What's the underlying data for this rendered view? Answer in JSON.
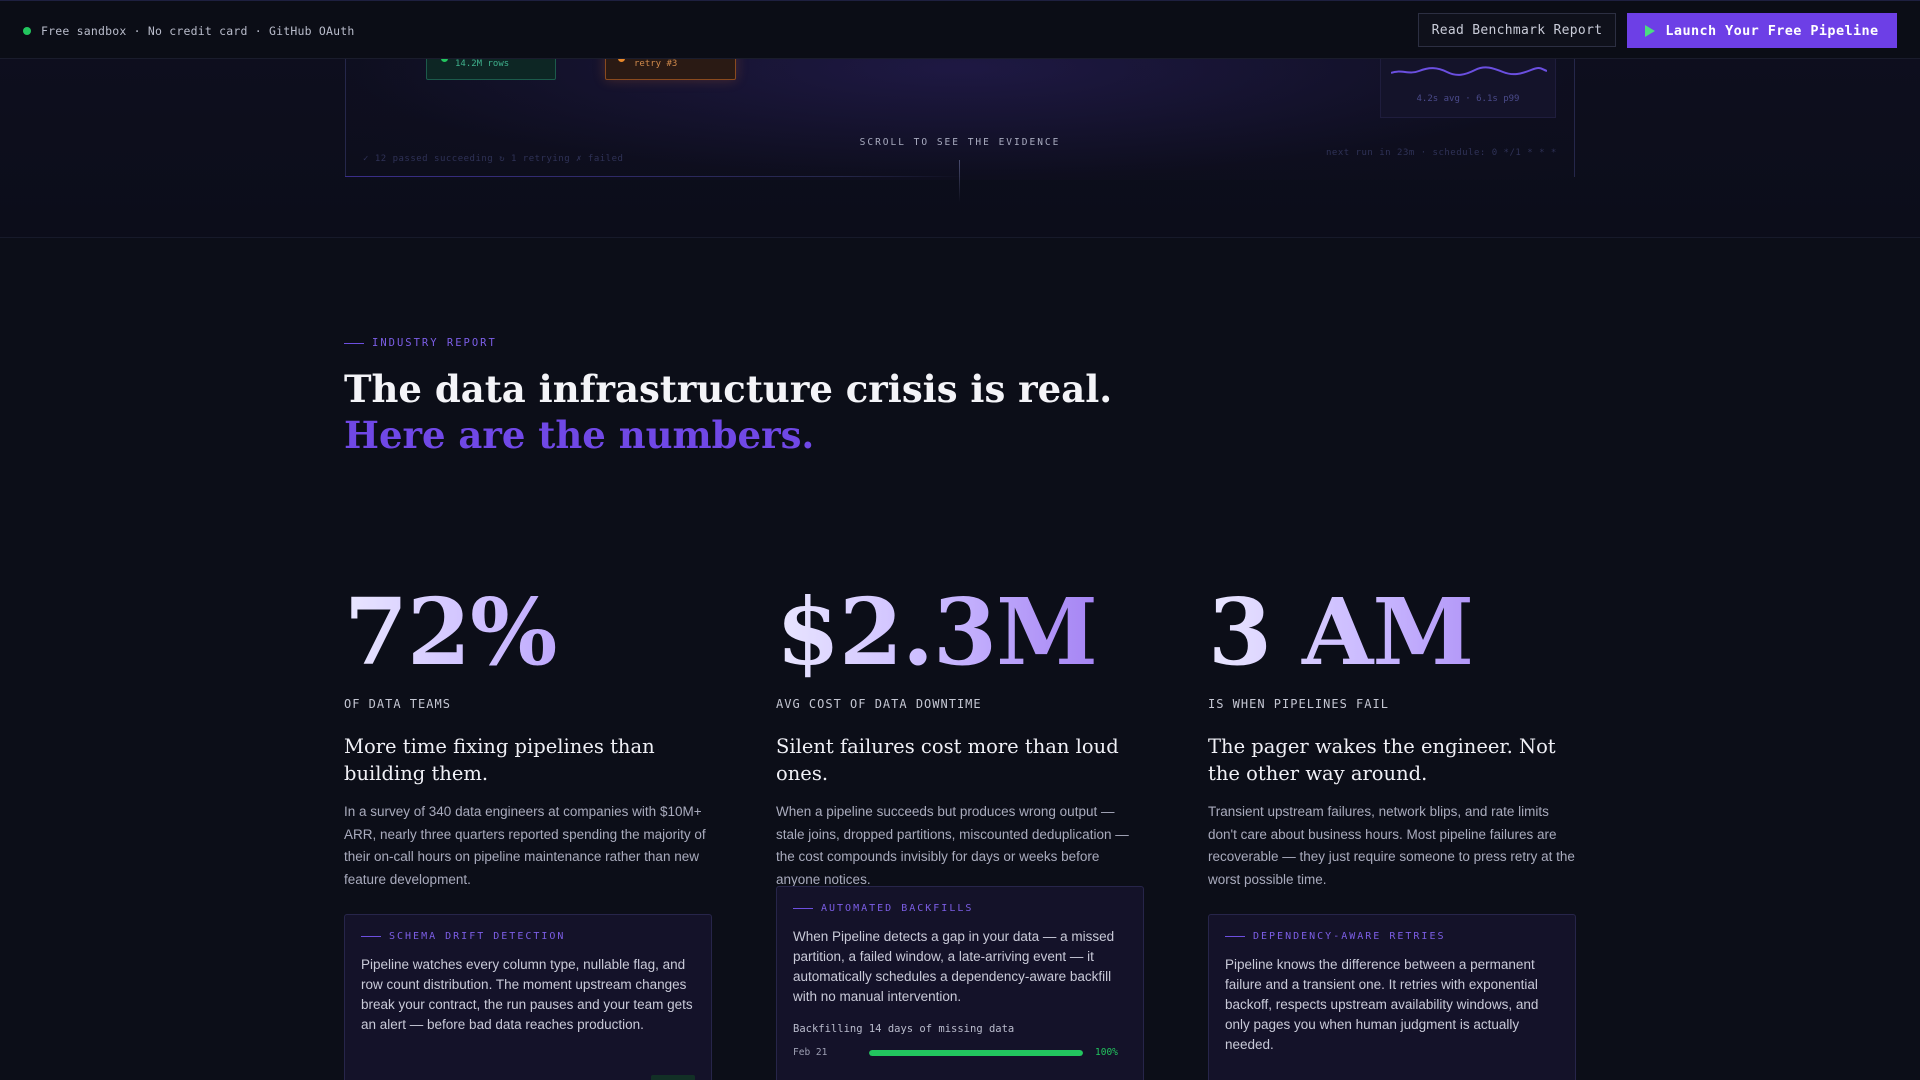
{
  "topbar": {
    "status_text": "Free sandbox · No credit card · GitHub OAuth",
    "secondary_cta": "Read Benchmark Report",
    "primary_cta": "Launch Your Free Pipeline"
  },
  "hero": {
    "node_ok_text": "14.2M rows",
    "node_retry_text": "retry #3",
    "latency_text": "4.2s avg · 6.1s p99",
    "scroll_hint": "SCROLL TO SEE THE EVIDENCE",
    "footer_left": "✓ 12 passed succeeding   ↻ 1 retrying   ✗ failed",
    "footer_right": "next run in 23m · schedule: 0 */1 * * *"
  },
  "section": {
    "eyebrow": "INDUSTRY REPORT",
    "headline": "The data infrastructure crisis is real.",
    "headline_accent": "Here are the numbers."
  },
  "stats": [
    {
      "value": "72%",
      "label": "OF DATA TEAMS",
      "title": "More time fixing pipelines than building them.",
      "body": "In a survey of 340 data engineers at companies with $10M+ ARR, nearly three quarters reported spending the majority of their on-call hours on pipeline maintenance rather than new feature development."
    },
    {
      "value": "$2.3M",
      "label": "AVG COST OF DATA DOWNTIME",
      "title": "Silent failures cost more than loud ones.",
      "body": "When a pipeline succeeds but produces wrong output — stale joins, dropped partitions, miscounted deduplication — the cost compounds invisibly for days or weeks before anyone notices."
    },
    {
      "value": "3 AM",
      "label": "IS WHEN PIPELINES FAIL",
      "title": "The pager wakes the engineer. Not the other way around.",
      "body": "Transient upstream failures, network blips, and rate limits don't care about business hours. Most pipeline failures are recoverable — they just require someone to press retry at the worst possible time."
    }
  ],
  "features": [
    {
      "eyebrow": "SCHEMA DRIFT DETECTION",
      "body": "Pipeline watches every column type, nullable flag, and row count distribution. The moment upstream changes break your contract, the run pauses and your team gets an alert — before bad data reaches production."
    },
    {
      "eyebrow": "AUTOMATED BACKFILLS",
      "body": "When Pipeline detects a gap in your data — a missed partition, a failed window, a late-arriving event — it automatically schedules a dependency-aware backfill with no manual intervention.",
      "backfill_title": "Backfilling 14 days of missing data",
      "rows": [
        {
          "date": "Feb 21",
          "pct_label": "100%",
          "progress": 1.0
        }
      ]
    },
    {
      "eyebrow": "DEPENDENCY-AWARE RETRIES",
      "body": "Pipeline knows the difference between a permanent failure and a transient one. It retries with exponential backoff, respects upstream availability windows, and only pages you when human judgment is actually needed."
    }
  ],
  "colors": {
    "accent": "#6d3fe6",
    "success": "#22c55e",
    "warning": "#e8892b",
    "background": "#0c0e18"
  }
}
